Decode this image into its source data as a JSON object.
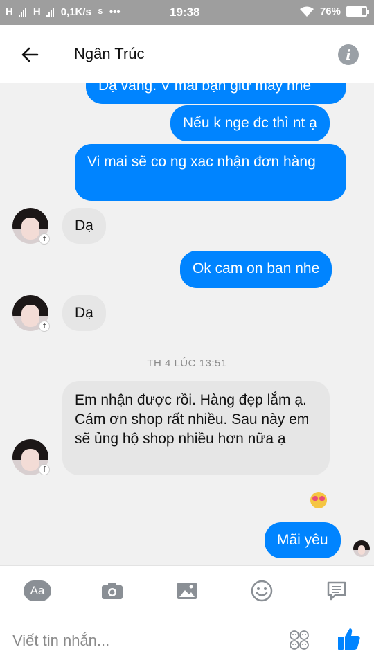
{
  "status_bar": {
    "network_1": "H",
    "network_2": "H",
    "speed": "0,1K/s",
    "notification_badge": "S",
    "more": "•••",
    "time": "19:38",
    "battery": "76%",
    "battery_level": 0.76
  },
  "header": {
    "title": "Ngân Trúc",
    "info_label": "i"
  },
  "messages": [
    {
      "direction": "out",
      "text": "Dạ vâng. V mai bạn giữ máy nhé"
    },
    {
      "direction": "out",
      "text": "Nếu k nge đc thì nt ạ"
    },
    {
      "direction": "out",
      "text": "Vi mai sẽ co ng xac nhận đơn hàng"
    },
    {
      "direction": "in",
      "text": "Dạ"
    },
    {
      "direction": "out",
      "text": "Ok cam on ban nhe"
    },
    {
      "direction": "in",
      "text": "Dạ"
    },
    {
      "direction": "timestamp",
      "text": "TH 4 LÚC 13:51"
    },
    {
      "direction": "in",
      "text": "Em nhận được rồi. Hàng đẹp lắm ạ. Cám ơn shop rất nhiều. Sau này em sẽ ủng hộ shop nhiều hơn nữa ạ"
    },
    {
      "direction": "out",
      "text": "Mãi yêu"
    }
  ],
  "reaction": "heart-eyes-emoji",
  "toolbar": {
    "aa_label": "Aa",
    "icons": [
      "camera-icon",
      "image-icon",
      "emoji-icon",
      "quick-reply-icon"
    ]
  },
  "composer": {
    "placeholder": "Viết tin nhắn...",
    "send_icon": "thumbs-up-icon"
  },
  "colors": {
    "outgoing_bubble": "#0084ff",
    "incoming_bubble": "#e6e6e6",
    "status_bar": "#9e9e9e"
  }
}
